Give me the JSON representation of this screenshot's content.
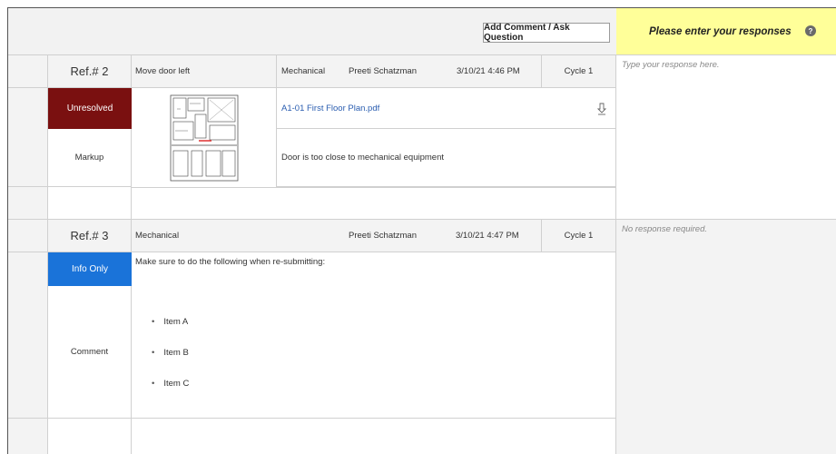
{
  "toolbar": {
    "add_comment_label": "Add Comment / Ask Question"
  },
  "responses": {
    "header": "Please enter your responses",
    "help_icon": "?"
  },
  "comments": [
    {
      "ref": "Ref.# 2",
      "title": "Move door left",
      "discipline": "Mechanical",
      "author": "Preeti Schatzman",
      "date": "3/10/21 4:46 PM",
      "cycle": "Cycle 1",
      "status": "Unresolved",
      "type": "Markup",
      "attachment": "A1-01 First Floor Plan.pdf",
      "body": "Door is too close to mechanical equipment",
      "response_placeholder": "Type your response here."
    },
    {
      "ref": "Ref.# 3",
      "discipline": "Mechanical",
      "author": "Preeti Schatzman",
      "date": "3/10/21 4:47 PM",
      "cycle": "Cycle 1",
      "status": "Info Only",
      "type": "Comment",
      "body": "Make sure to do the following when re-submitting:",
      "items": [
        "Item A",
        "Item B",
        "Item C"
      ],
      "response_note": "No response required."
    }
  ],
  "colors": {
    "unresolved": "#7a1010",
    "info_only": "#1a73d9",
    "response_header": "#ffff99"
  }
}
